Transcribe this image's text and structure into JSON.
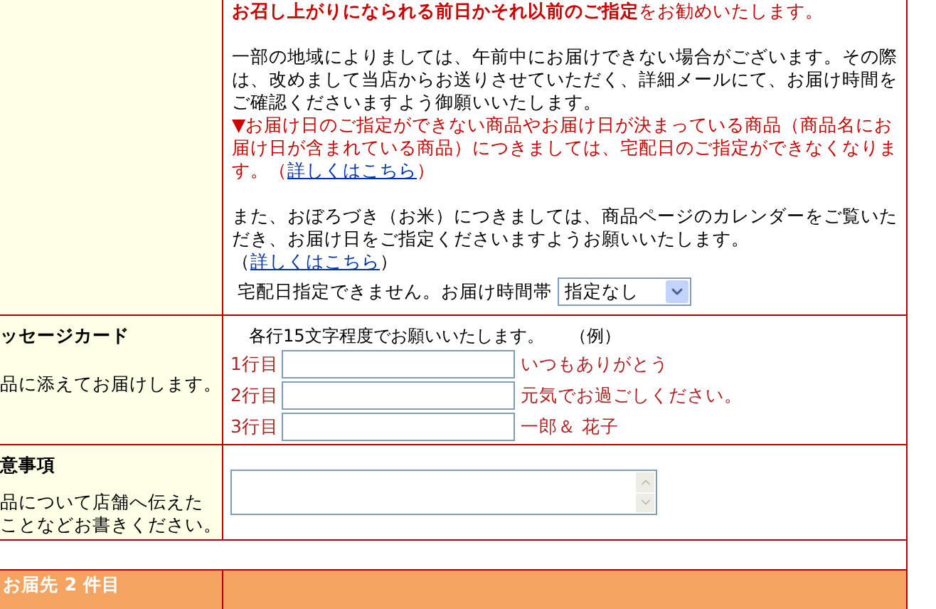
{
  "delivery": {
    "intro": "**お召し上がりになられる前日かそれ以前のご指定**をお勧めいたします。",
    "morning_notice": "一部の地域によりましては、午前中にお届けできない場合がございます。その際は、改めまして当店からお送りさせていただく、詳細メールにて、お届け時間をご確認くださいますよう御願いいたします。",
    "warning": {
      "text": "▼お届け日のご指定ができない商品やお届け日が決まっている商品（商品名にお届け日が含まれている商品）につきましては、宅配日のご指定ができなくなります。（",
      "link": "詳しくはこちら",
      "after": "）"
    },
    "rice_notice": {
      "text": "また、おぼろづき（お米）につきましては、商品ページのカレンダーをご覧いただき、お届け日をご指定くださいますようお願いいたします。（",
      "link": "詳しくはこちら",
      "after": "）"
    },
    "time_label": "宅配日指定できません。お届け時間帯",
    "time_select": "指定なし"
  },
  "message_card": {
    "title": "ッセージカード",
    "description": "品に添えてお届けします。",
    "instruction": "各行15文字程度でお願いいたします。",
    "example_label": "（例）",
    "lines": [
      {
        "label": "1行目",
        "example": "いつもありがとう"
      },
      {
        "label": "2行目",
        "example": "元気でお過ごしください。"
      },
      {
        "label": "3行目",
        "example": "一郎＆ 花子"
      }
    ]
  },
  "notes": {
    "title": "意事項",
    "description": [
      "品について店舗へ伝えた",
      "ことなどお書きください。"
    ]
  },
  "next_section": {
    "title": "お届先 2 件目"
  }
}
